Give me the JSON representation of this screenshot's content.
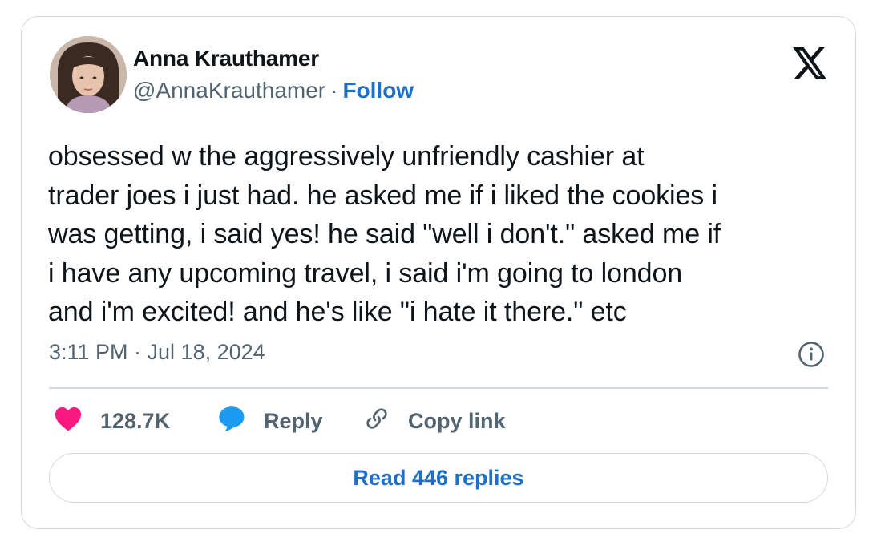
{
  "author": {
    "name": "Anna Krauthamer",
    "handle": "@AnnaKrauthamer",
    "separator": "·",
    "follow_label": "Follow"
  },
  "tweet": {
    "lines": [
      "obsessed w the aggressively unfriendly cashier at",
      "trader joes i just had. he asked me if i liked the cookies i",
      "was getting, i said yes! he said \"well i don't.\" asked me if",
      "i have any upcoming travel, i said i'm going to london",
      "and i'm excited! and he's like \"i hate it there.\" etc"
    ],
    "timestamp": "3:11 PM · Jul 18, 2024"
  },
  "actions": {
    "like_count": "128.7K",
    "reply_label": "Reply",
    "copy_link_label": "Copy link",
    "read_replies_label": "Read 446 replies"
  },
  "icons": {
    "logo": "x-logo-icon",
    "info": "info-icon",
    "like": "heart-icon",
    "reply": "speech-bubble-icon",
    "copy": "link-icon"
  },
  "colors": {
    "text": "#0f1419",
    "muted": "#536471",
    "link": "#1d6fc9",
    "heart": "#f91880",
    "reply_bubble": "#1d9bf0",
    "border": "#cfd9de"
  }
}
